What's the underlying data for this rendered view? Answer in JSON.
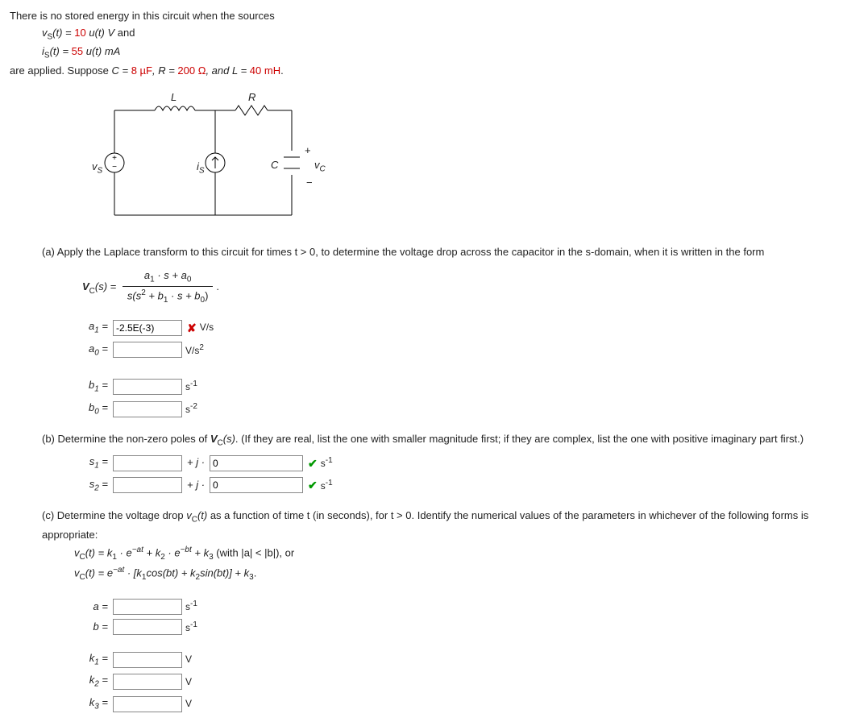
{
  "intro": {
    "line1_pre": "There is no stored energy in this circuit when the sources",
    "vs_lhs": "v",
    "vs_sub": "S",
    "vs_arg": "(t) = ",
    "vs_val": "10 ",
    "vs_ut": "u(t) V",
    "and": " and",
    "is_lhs": "i",
    "is_sub": "S",
    "is_arg": "(t) = ",
    "is_val": "55 ",
    "is_ut": "u(t) mA",
    "applied_pre": "are applied. Suppose ",
    "C_lbl": "C = ",
    "C_val": "8 µF",
    "R_lbl": ", R = ",
    "R_val": "200 Ω",
    "L_lbl": ", and L = ",
    "L_val": "40 mH",
    "period": "."
  },
  "circuit": {
    "L": "L",
    "R": "R",
    "vs": "v",
    "vs_sub": "S",
    "is": "i",
    "is_sub": "S",
    "C": "C",
    "vc": "v",
    "vc_sub": "C",
    "plus": "+",
    "minus": "−"
  },
  "partA": {
    "prompt": "(a) Apply the Laplace transform to this circuit for times t > 0, to determine the voltage drop across the capacitor in the s-domain, when it is written in the form",
    "Vc_lhs": "V",
    "Vc_sub_C": "C",
    "Vc_arg": "(s) = ",
    "num_a1": "a",
    "num_1": "1",
    "num_dot_s": " · s + ",
    "num_a0": "a",
    "num_0": "0",
    "den_s": "s(s",
    "den_sq": "2",
    "den_b1": " + b",
    "den_1": "1",
    "den_dot_s": " · s + ",
    "den_b0": "b",
    "den_0": "0",
    "den_close": ")",
    "a1_lbl": "a",
    "a1_sub": "1",
    "a1_val": "-2.5E(-3)",
    "a1_unit": "V/s",
    "a0_lbl": "a",
    "a0_sub": "0",
    "a0_unit_v": "V/s",
    "a0_unit_sq": "2",
    "b1_lbl": "b",
    "b1_sub": "1",
    "b1_unit": "s",
    "b1_exp": "-1",
    "b0_lbl": "b",
    "b0_sub": "0",
    "b0_unit": "s",
    "b0_exp": "-2"
  },
  "partB": {
    "prompt": "(b) Determine the non-zero poles of ",
    "Vc": "V",
    "Vc_sub": "C",
    "Vc_arg": "(s)",
    "prompt_rest": ". (If they are real, list the one with smaller magnitude first; if they are complex, list the one with positive imaginary part first.)",
    "s1_lbl": "s",
    "s1_sub": "1",
    "plus_j": "+ j · ",
    "s1_im": "0",
    "s_unit": "s",
    "s_exp": "-1",
    "s2_lbl": "s",
    "s2_sub": "2",
    "s2_im": "0"
  },
  "partC": {
    "prompt": "(c) Determine the voltage drop ",
    "vc": "v",
    "vc_sub": "C",
    "vc_arg": "(t)",
    "prompt_mid": " as a function of time t (in seconds), for t > 0. Identify the numerical values of the parameters in whichever of the following forms is appropriate:",
    "eq1_vc": "v",
    "eq1_sub": "C",
    "eq1_arg": "(t) = k",
    "eq1_k1": "1",
    "eq1_eat": " · e",
    "eq1_exp_at": "−at",
    "eq1_pk2": " + k",
    "eq1_k2": "2",
    "eq1_ebt": " · e",
    "eq1_exp_bt": "−bt",
    "eq1_pk3": " + k",
    "eq1_k3": "3",
    "eq1_with": " (with |a| < |b|), or",
    "eq2_vc": "v",
    "eq2_sub": "C",
    "eq2_arg": "(t) = e",
    "eq2_exp_at": "−at",
    "eq2_brkt": " · [k",
    "eq2_k1": "1",
    "eq2_cos": "cos(bt) + k",
    "eq2_k2": "2",
    "eq2_sin": "sin(bt)] + k",
    "eq2_k3": "3",
    "eq2_end": ".",
    "a_lbl": "a",
    "b_lbl": "b",
    "s_unit": "s",
    "s_exp": "-1",
    "k1_lbl": "k",
    "k1_sub": "1",
    "k2_lbl": "k",
    "k2_sub": "2",
    "k3_lbl": "k",
    "k3_sub": "3",
    "V_unit": "V"
  }
}
